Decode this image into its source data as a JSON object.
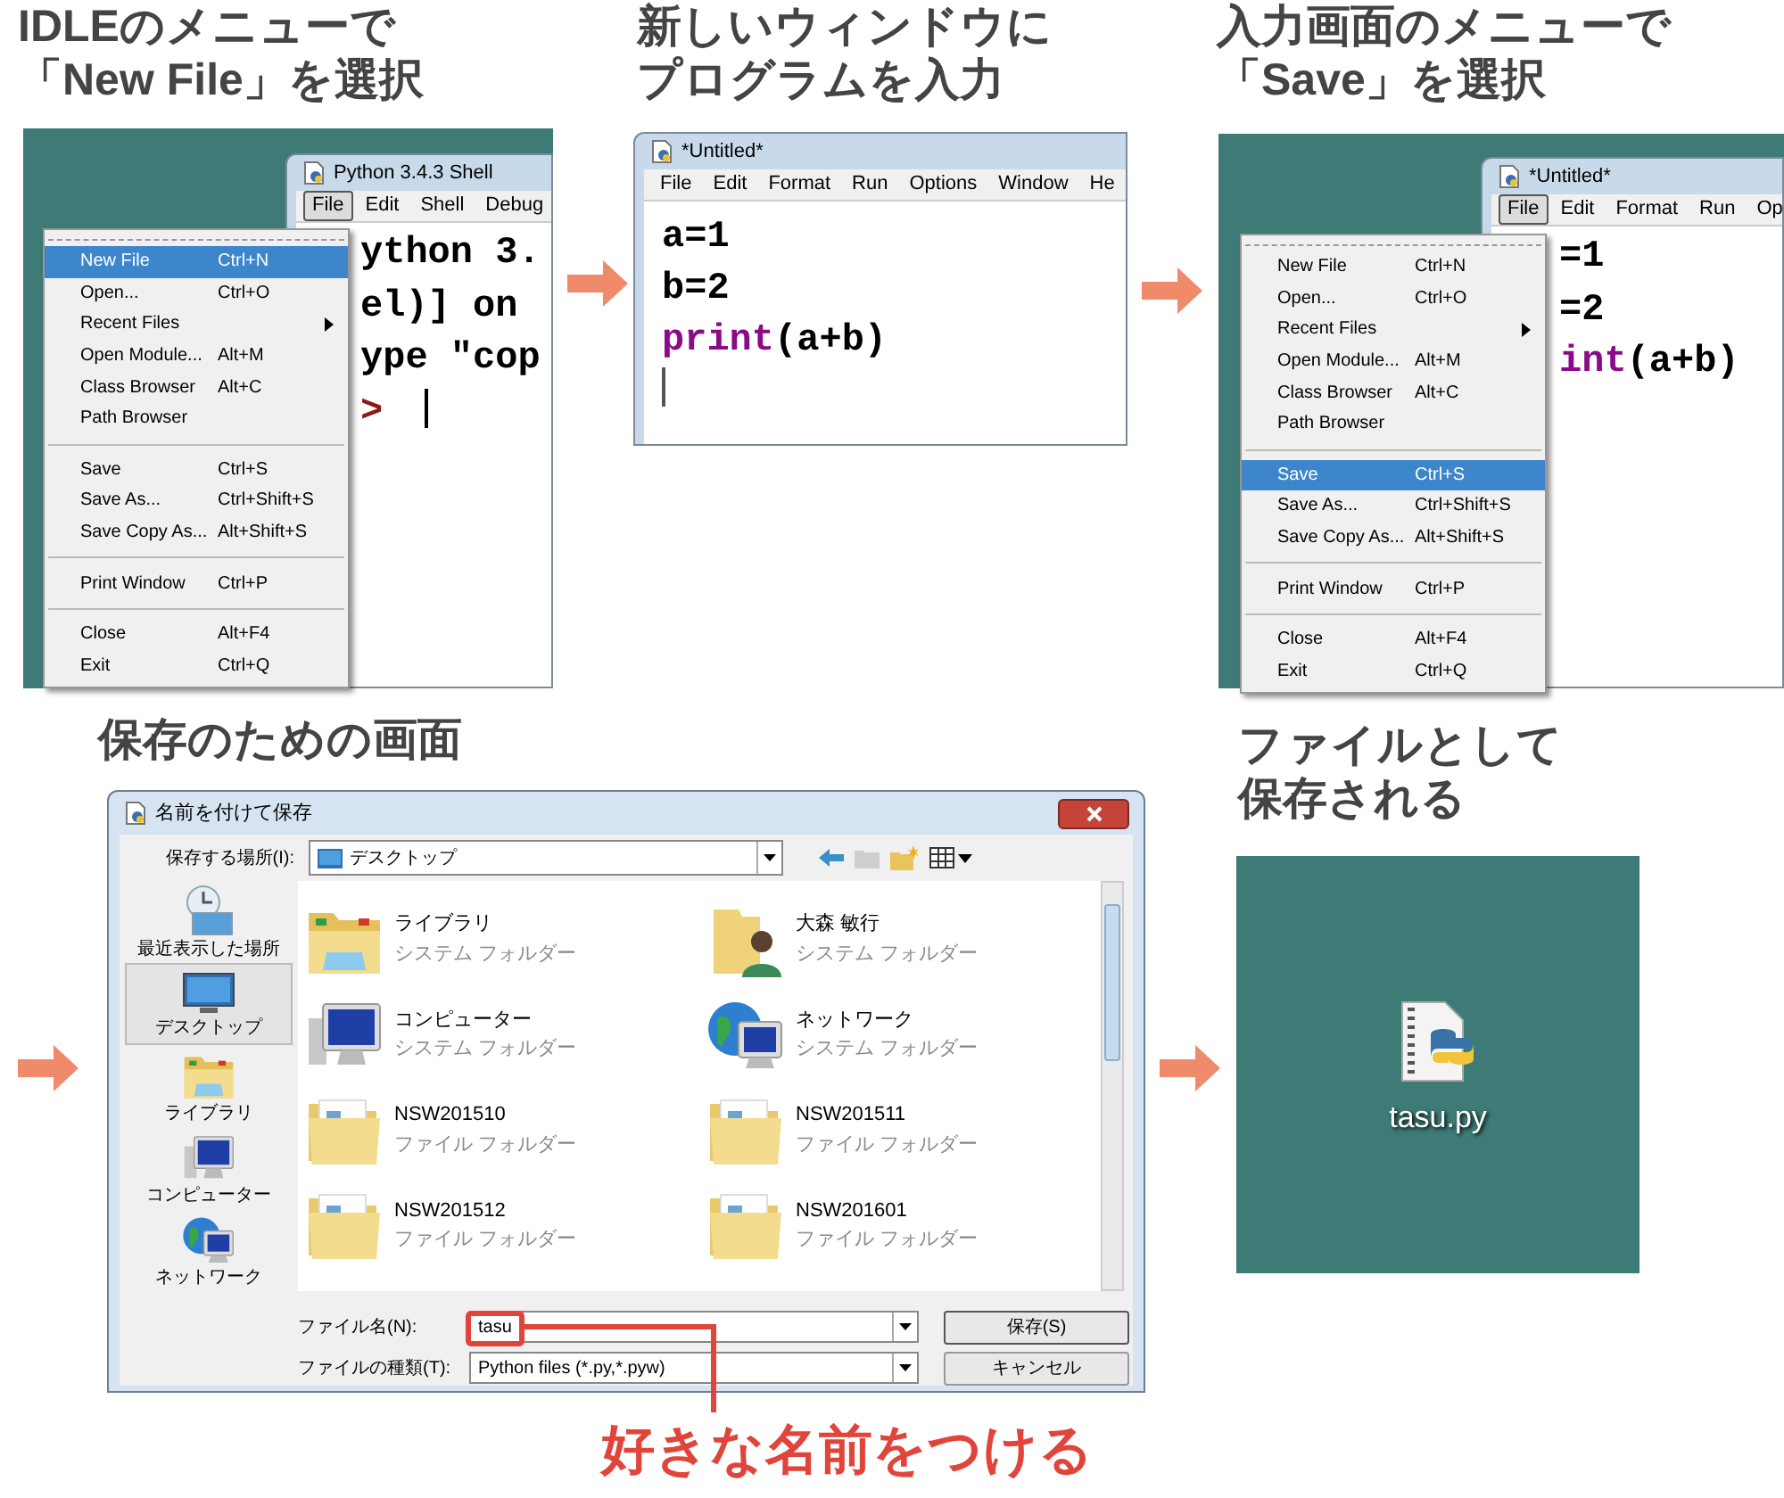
{
  "steps": [
    {
      "caption": [
        "IDLEのメニューで",
        "「New File」を選択"
      ],
      "window": {
        "title": "Python 3.4.3 Shell",
        "menubar": [
          {
            "label": "File",
            "selected": true
          },
          {
            "label": "Edit",
            "selected": false
          },
          {
            "label": "Shell",
            "selected": false
          },
          {
            "label": "Debug",
            "selected": false
          }
        ],
        "code": [
          [
            {
              "kind": "plain",
              "text": "ython 3."
            }
          ],
          [
            {
              "kind": "plain",
              "text": "el)] on"
            }
          ],
          [
            {
              "kind": "plain",
              "text": "ype \"cop"
            }
          ],
          [
            {
              "kind": "prompt",
              "text": ">"
            }
          ]
        ]
      },
      "menu": [
        {
          "kind": "item",
          "label": "New File",
          "shortcut": "Ctrl+N",
          "selected": true
        },
        {
          "kind": "item",
          "label": "Open...",
          "shortcut": "Ctrl+O",
          "selected": false
        },
        {
          "kind": "item",
          "label": "Recent Files",
          "submenu": true,
          "selected": false
        },
        {
          "kind": "item",
          "label": "Open Module...",
          "shortcut": "Alt+M",
          "selected": false
        },
        {
          "kind": "item",
          "label": "Class Browser",
          "shortcut": "Alt+C",
          "selected": false
        },
        {
          "kind": "item",
          "label": "Path Browser",
          "selected": false
        },
        {
          "kind": "separator"
        },
        {
          "kind": "item",
          "label": "Save",
          "shortcut": "Ctrl+S",
          "selected": false
        },
        {
          "kind": "item",
          "label": "Save As...",
          "shortcut": "Ctrl+Shift+S",
          "selected": false
        },
        {
          "kind": "item",
          "label": "Save Copy As...",
          "shortcut": "Alt+Shift+S",
          "selected": false
        },
        {
          "kind": "separator"
        },
        {
          "kind": "item",
          "label": "Print Window",
          "shortcut": "Ctrl+P",
          "selected": false
        },
        {
          "kind": "separator"
        },
        {
          "kind": "item",
          "label": "Close",
          "shortcut": "Alt+F4",
          "selected": false
        },
        {
          "kind": "item",
          "label": "Exit",
          "shortcut": "Ctrl+Q",
          "selected": false
        }
      ]
    },
    {
      "caption": [
        "新しいウィンドウに",
        "プログラムを入力"
      ],
      "window": {
        "title": "*Untitled*",
        "menubar": [
          {
            "label": "File",
            "selected": false
          },
          {
            "label": "Edit",
            "selected": false
          },
          {
            "label": "Format",
            "selected": false
          },
          {
            "label": "Run",
            "selected": false
          },
          {
            "label": "Options",
            "selected": false
          },
          {
            "label": "Window",
            "selected": false
          },
          {
            "label": "He",
            "selected": false
          }
        ],
        "code": [
          [
            {
              "kind": "plain",
              "text": "a=1"
            }
          ],
          [
            {
              "kind": "plain",
              "text": "b=2"
            }
          ],
          [
            {
              "kind": "keyword",
              "text": "print"
            },
            {
              "kind": "plain",
              "text": "(a+b)"
            }
          ]
        ]
      }
    },
    {
      "caption": [
        "入力画面のメニューで",
        "「Save」を選択"
      ],
      "window": {
        "title": "*Untitled*",
        "menubar": [
          {
            "label": "File",
            "selected": true
          },
          {
            "label": "Edit",
            "selected": false
          },
          {
            "label": "Format",
            "selected": false
          },
          {
            "label": "Run",
            "selected": false
          },
          {
            "label": "Op",
            "selected": false
          }
        ],
        "code": [
          [
            {
              "kind": "plain",
              "text": "=1"
            }
          ],
          [
            {
              "kind": "plain",
              "text": "=2"
            }
          ],
          [
            {
              "kind": "keyword",
              "text": "int"
            },
            {
              "kind": "plain",
              "text": "(a+b)"
            }
          ]
        ]
      },
      "menu": [
        {
          "kind": "item",
          "label": "New File",
          "shortcut": "Ctrl+N",
          "selected": false
        },
        {
          "kind": "item",
          "label": "Open...",
          "shortcut": "Ctrl+O",
          "selected": false
        },
        {
          "kind": "item",
          "label": "Recent Files",
          "submenu": true,
          "selected": false
        },
        {
          "kind": "item",
          "label": "Open Module...",
          "shortcut": "Alt+M",
          "selected": false
        },
        {
          "kind": "item",
          "label": "Class Browser",
          "shortcut": "Alt+C",
          "selected": false
        },
        {
          "kind": "item",
          "label": "Path Browser",
          "selected": false
        },
        {
          "kind": "separator"
        },
        {
          "kind": "item",
          "label": "Save",
          "shortcut": "Ctrl+S",
          "selected": true
        },
        {
          "kind": "item",
          "label": "Save As...",
          "shortcut": "Ctrl+Shift+S",
          "selected": false
        },
        {
          "kind": "item",
          "label": "Save Copy As...",
          "shortcut": "Alt+Shift+S",
          "selected": false
        },
        {
          "kind": "separator"
        },
        {
          "kind": "item",
          "label": "Print Window",
          "shortcut": "Ctrl+P",
          "selected": false
        },
        {
          "kind": "separator"
        },
        {
          "kind": "item",
          "label": "Close",
          "shortcut": "Alt+F4",
          "selected": false
        },
        {
          "kind": "item",
          "label": "Exit",
          "shortcut": "Ctrl+Q",
          "selected": false
        }
      ]
    }
  ],
  "save_dialog": {
    "caption": "保存のための画面",
    "title": "名前を付けて保存",
    "location_label": "保存する場所(I):",
    "location": "デスクトップ",
    "places": [
      {
        "kind": "recent",
        "label": "最近表示した場所",
        "selected": false
      },
      {
        "kind": "desktop",
        "label": "デスクトップ",
        "selected": true
      },
      {
        "kind": "library",
        "label": "ライブラリ",
        "selected": false
      },
      {
        "kind": "computer",
        "label": "コンピューター",
        "selected": false
      },
      {
        "kind": "network",
        "label": "ネットワーク",
        "selected": false
      }
    ],
    "items": [
      {
        "kind": "library",
        "name": "ライブラリ",
        "type": "システム フォルダー"
      },
      {
        "kind": "user",
        "name": "大森 敏行",
        "type": "システム フォルダー"
      },
      {
        "kind": "computer",
        "name": "コンピューター",
        "type": "システム フォルダー"
      },
      {
        "kind": "network",
        "name": "ネットワーク",
        "type": "システム フォルダー"
      },
      {
        "kind": "folder",
        "name": "NSW201510",
        "type": "ファイル フォルダー"
      },
      {
        "kind": "folder",
        "name": "NSW201511",
        "type": "ファイル フォルダー"
      },
      {
        "kind": "folder",
        "name": "NSW201512",
        "type": "ファイル フォルダー"
      },
      {
        "kind": "folder",
        "name": "NSW201601",
        "type": "ファイル フォルダー"
      }
    ],
    "filename_label": "ファイル名(N):",
    "filename": "tasu",
    "filetype_label": "ファイルの種類(T):",
    "filetype": "Python files (*.py,*.pyw)",
    "buttons": [
      "保存(S)",
      "キャンセル"
    ],
    "callout": "好きな名前をつける"
  },
  "result": {
    "caption": [
      "ファイルとして",
      "保存される"
    ],
    "file": "tasu.py"
  }
}
